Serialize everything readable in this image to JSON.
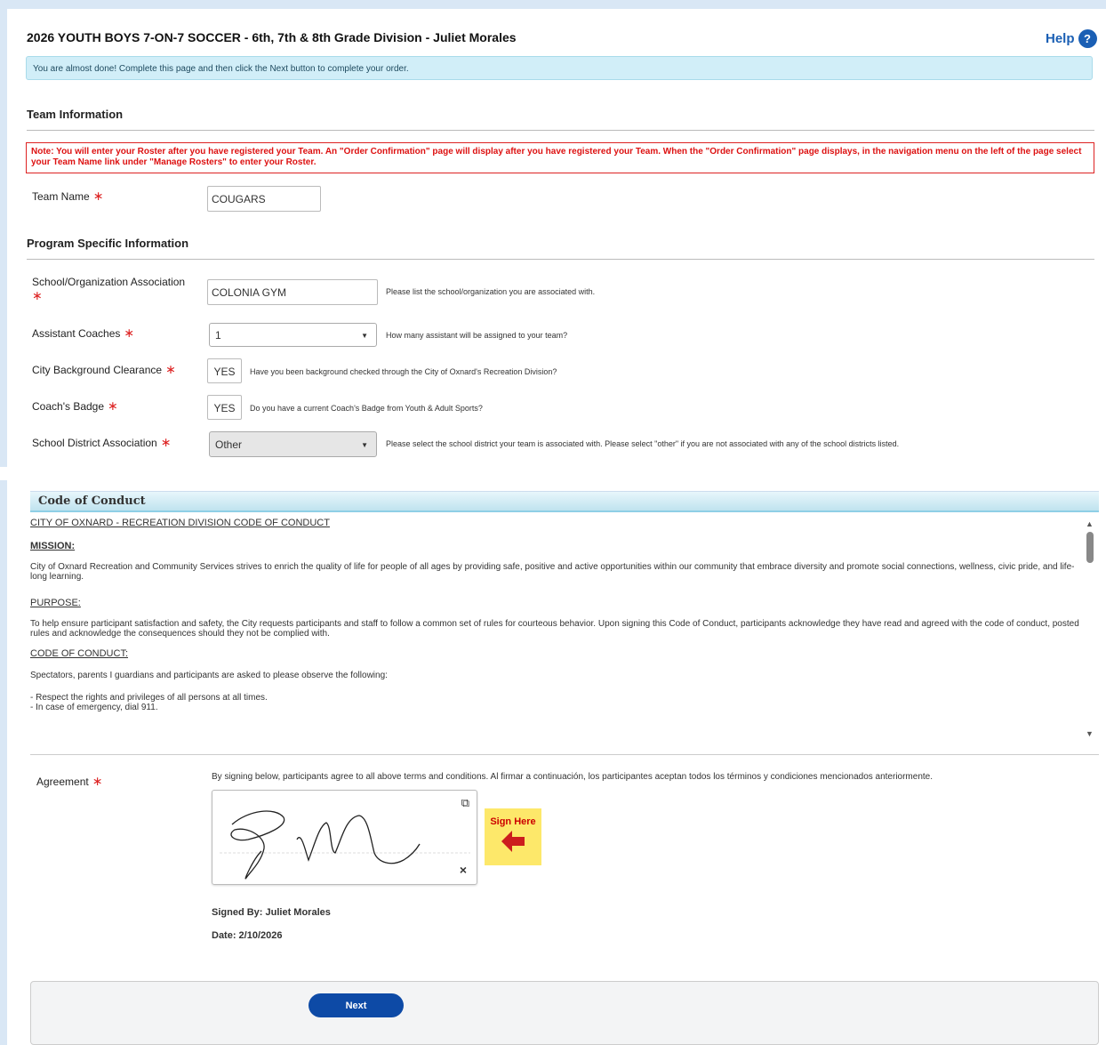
{
  "header": {
    "title": "2026 YOUTH BOYS 7-ON-7 SOCCER - 6th, 7th & 8th Grade Division - Juliet Morales",
    "help_label": "Help",
    "help_icon": "?"
  },
  "info_banner": "You are almost done! Complete this page and then click the Next button to complete your order.",
  "team_info": {
    "heading": "Team Information",
    "note": "Note: You will enter your Roster after you have registered your Team. An \"Order Confirmation\" page will display after you have registered your Team. When the \"Order Confirmation\" page displays, in the navigation menu on the left of the page select your Team Name link under \"Manage Rosters\" to enter your Roster.",
    "team_name_label": "Team Name",
    "team_name_value": "COUGARS"
  },
  "program_info": {
    "heading": "Program Specific Information",
    "school_org_label": "School/Organization Association",
    "school_org_value": "COLONIA GYM",
    "school_org_hint": "Please list the school/organization you are associated with.",
    "assistant_label": "Assistant Coaches",
    "assistant_value": "1",
    "assistant_hint": "How many assistant will be assigned to your team?",
    "clearance_label": "City Background Clearance",
    "clearance_value": "YES",
    "clearance_hint": "Have you been background checked through the City of Oxnard's Recreation Division?",
    "badge_label": "Coach's Badge",
    "badge_value": "YES",
    "badge_hint": "Do you have a current Coach's Badge from Youth & Adult Sports?",
    "district_label": "School District Association",
    "district_value": "Other",
    "district_hint": "Please select the school district your team is associated with. Please select \"other\" if you are not associated with any of the school districts listed."
  },
  "code_of_conduct": {
    "heading": "Code of Conduct",
    "title": "CITY OF OXNARD - RECREATION DIVISION CODE OF CONDUCT",
    "mission_heading": "MISSION:",
    "mission_text": "City of Oxnard Recreation and Community Services strives to enrich the quality of life for people of all ages by providing safe, positive and active opportunities within our community that embrace diversity and promote social connections, wellness, civic pride, and life-long learning.",
    "purpose_heading": "PURPOSE:",
    "purpose_text": "To help ensure participant satisfaction and safety, the City requests participants and staff to follow a common set of rules for courteous behavior. Upon signing this Code of Conduct, participants acknowledge they have read and agreed with the code of conduct, posted rules and acknowledge the consequences should they not be complied with.",
    "conduct_heading": "CODE OF CONDUCT:",
    "conduct_intro": "Spectators, parents I guardians and participants are asked to please observe the following:",
    "rule1": "- Respect the rights and privileges of all persons at all times.",
    "rule2": "- In case of emergency, dial 911."
  },
  "agreement": {
    "label": "Agreement",
    "text": "By signing below, participants agree to all above terms and conditions. Al firmar a continuación, los participantes aceptan todos los términos y condiciones mencionados anteriormente.",
    "sign_here": "Sign Here",
    "signed_by": "Signed By: Juliet Morales",
    "date": "Date: 2/10/2026"
  },
  "footer": {
    "next_label": "Next"
  },
  "colors": {
    "accent": "#1a5fb4",
    "required": "#dd2222",
    "next_button": "#0d4aa6"
  }
}
